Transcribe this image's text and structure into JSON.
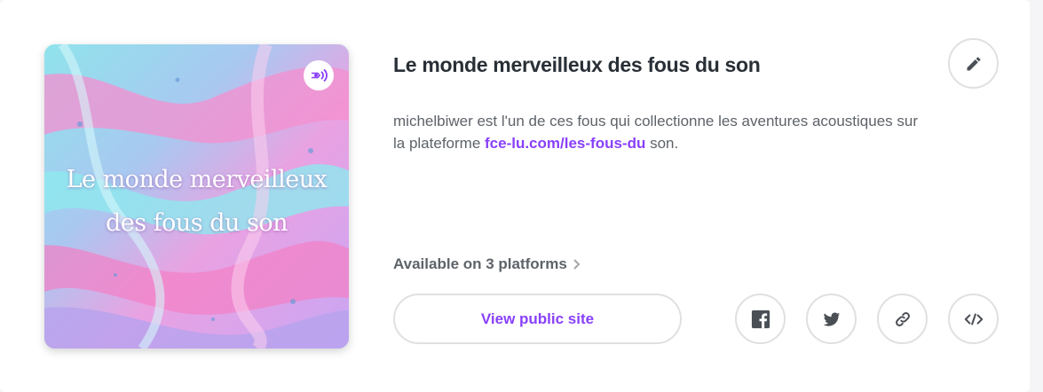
{
  "podcast": {
    "title": "Le monde merveilleux des fous du son",
    "cover_text": "Le monde merveilleux des fous du son",
    "cover_badge_icon": "anchor-podcast-icon",
    "description_before": "michelbiwer est l'un de ces fous qui collectionne les aventures acoustiques sur la plateforme ",
    "description_link": "fce-lu.com/les-fous-du",
    "description_after": " son."
  },
  "platforms": {
    "label": "Available on 3 platforms",
    "icon": "chevron-right-icon"
  },
  "actions": {
    "view_public_site": "View public site",
    "edit_icon": "pencil-icon",
    "share_icons": [
      "facebook-icon",
      "twitter-icon",
      "link-icon",
      "embed-code-icon"
    ]
  },
  "colors": {
    "accent": "#8940fa",
    "text_primary": "#292f36",
    "text_secondary": "#5e6369",
    "border": "#dfe0e1"
  }
}
